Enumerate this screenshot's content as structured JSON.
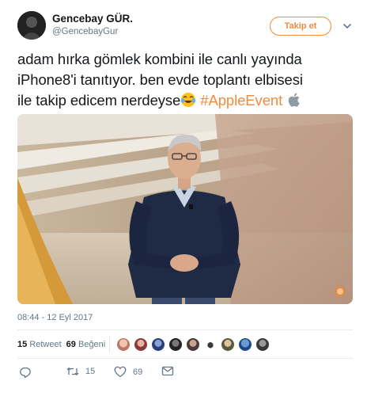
{
  "user": {
    "display_name": "Gencebay GÜR.",
    "handle": "@GencebayGur"
  },
  "follow_button": {
    "label": "Takip et"
  },
  "tweet": {
    "line1": "adam hırka gömlek kombini ile canlı yayında",
    "line2": "iPhone8'i tanıtıyor. ben evde toplantı elbisesi",
    "line3_text": "ile takip edicem nerdeyse",
    "hashtag": "#AppleEvent"
  },
  "timestamp": "08:44 - 12 Eyl 2017",
  "stats": {
    "retweet_count": "15",
    "retweet_label": "Retweet",
    "like_count": "69",
    "like_label": "Beğeni"
  },
  "actions": {
    "retweets": "15",
    "likes": "69"
  },
  "colors": {
    "accent": "#f58a3c",
    "secondary_text": "#657786",
    "divider": "#e6ecf0"
  },
  "icons": {
    "reply": "reply-icon",
    "retweet": "retweet-icon",
    "like": "heart-icon",
    "message": "envelope-icon",
    "more": "chevron-down-icon",
    "emoji": "tears-of-joy-emoji",
    "hashflag": "apple-logo-icon"
  }
}
